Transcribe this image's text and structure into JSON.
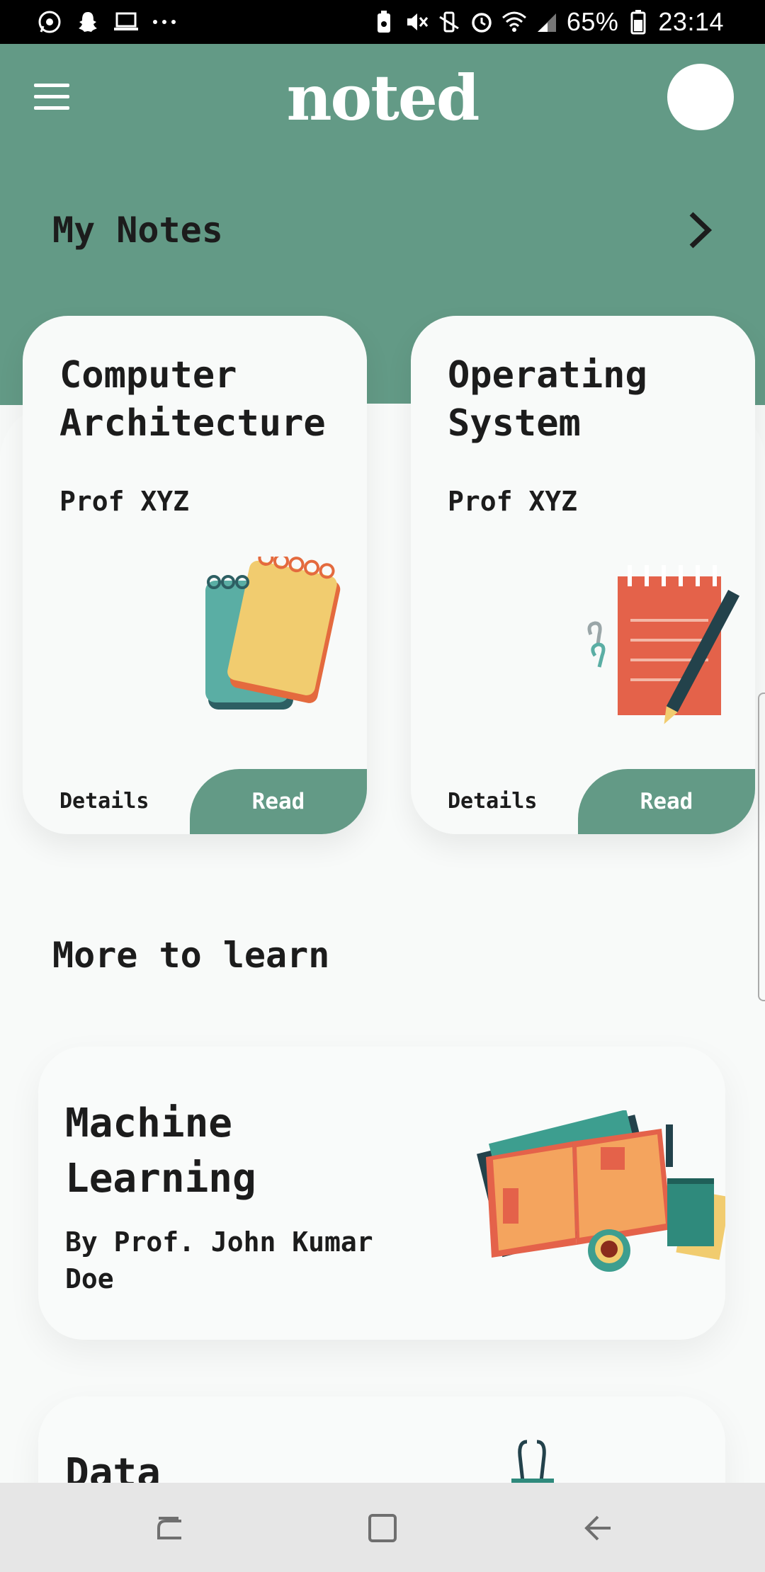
{
  "status_bar": {
    "battery_percent": "65%",
    "time": "23:14",
    "left_icons": [
      "whatsapp-icon",
      "snapchat-icon",
      "laptop-icon",
      "more-dots-icon"
    ],
    "right_icons": [
      "battery-saver-icon",
      "mute-icon",
      "vibrate-icon",
      "alarm-icon",
      "wifi-icon",
      "signal-icon",
      "battery-icon"
    ]
  },
  "header": {
    "logo": "noted",
    "menu_icon": "hamburger-menu-icon",
    "avatar": "profile-avatar",
    "color": "#639a86"
  },
  "my_notes": {
    "title": "My Notes",
    "arrow_icon": "chevron-right-icon",
    "cards": [
      {
        "title": "Computer Architecture",
        "professor": "Prof XYZ",
        "details_label": "Details",
        "read_label": "Read",
        "art": "notepads-illustration"
      },
      {
        "title": "Operating System",
        "professor": "Prof XYZ",
        "details_label": "Details",
        "read_label": "Read",
        "art": "notepad-pencil-illustration"
      }
    ]
  },
  "more_to_learn": {
    "title": "More to learn",
    "courses": [
      {
        "title": "Machine Learning",
        "author": "By Prof. John Kumar Doe",
        "art": "open-book-illustration"
      },
      {
        "title": "Data",
        "art": "binder-clip-illustration"
      }
    ]
  },
  "nav_bar": {
    "buttons": [
      "recent-apps-icon",
      "home-icon",
      "back-icon"
    ]
  }
}
